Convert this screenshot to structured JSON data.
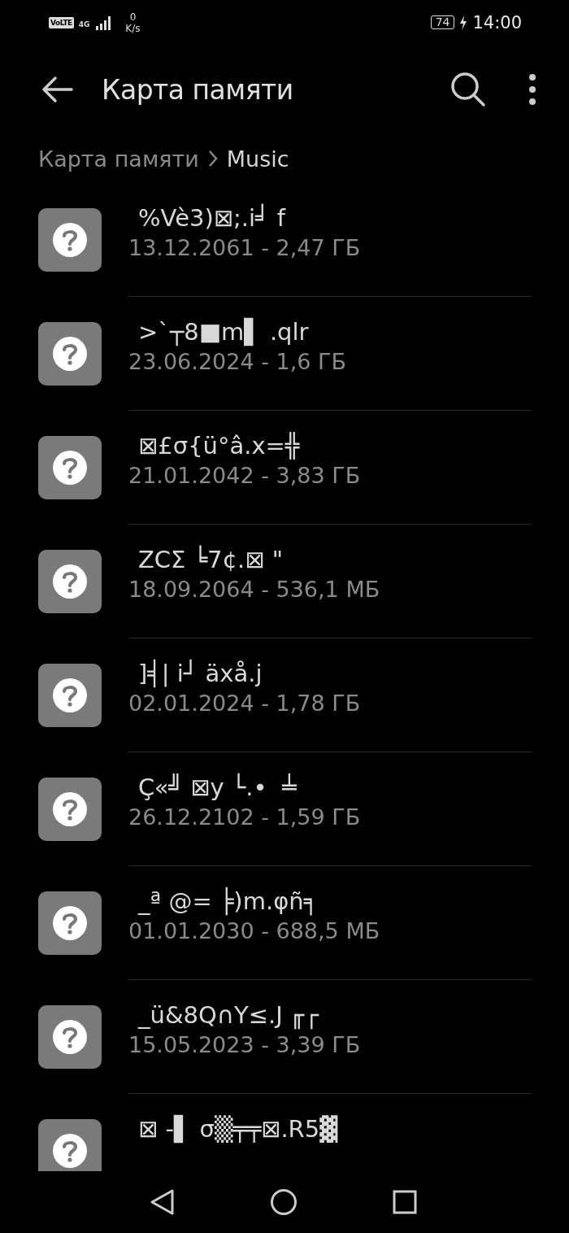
{
  "status_bar": {
    "volte": "VoLTE",
    "network": "4G",
    "speed_value": "0",
    "speed_unit": "K/s",
    "battery": "74",
    "charging": true,
    "time": "14:00"
  },
  "toolbar": {
    "title": "Карта памяти"
  },
  "breadcrumb": [
    {
      "label": "Карта памяти",
      "selected": false
    },
    {
      "label": "Music",
      "selected": true
    }
  ],
  "files": [
    {
      "name": "%Vè3)⊠;.i╛ f",
      "meta": "13.12.2061 - 2,47 ГБ"
    },
    {
      "name": ">`┬8■m▌ .qlr",
      "meta": "23.06.2024 - 1,6 ГБ"
    },
    {
      "name": "⊠£σ{ü°â.x=╬",
      "meta": "21.01.2042 - 3,83 ГБ"
    },
    {
      "name": "ZCΣ ╘7¢.⊠ \"",
      "meta": "18.09.2064 - 536,1 МБ"
    },
    {
      "name": "]╡| i┘ äxå.j",
      "meta": "02.01.2024 - 1,78 ГБ"
    },
    {
      "name": "Ç«╝ ⊠y └.•  ╧",
      "meta": "26.12.2102 - 1,59 ГБ"
    },
    {
      "name": "_ª @= ╞)m.φñ╕",
      "meta": "01.01.2030 - 688,5 МБ"
    },
    {
      "name": "_ü&8Q∩Y≤.J ╓┌",
      "meta": "15.05.2023 - 3,39 ГБ"
    },
    {
      "name": "⊠ -▌ σ▒╤╤⊠.R5▓"
    }
  ]
}
